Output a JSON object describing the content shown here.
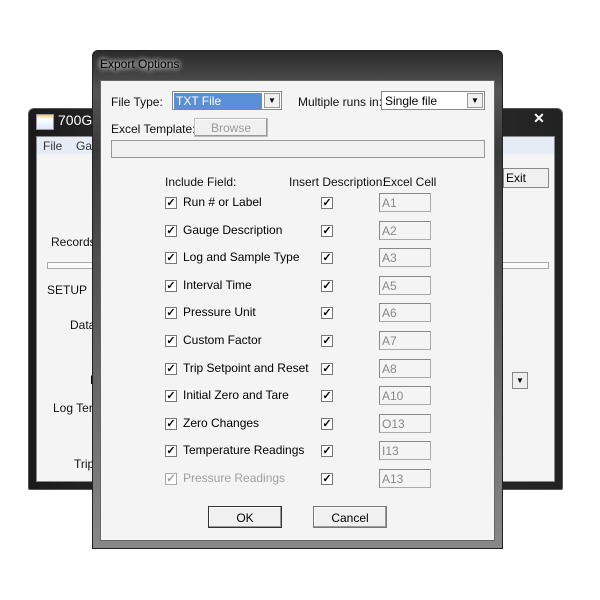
{
  "background_window": {
    "title": "700G",
    "close_icon": "close-icon",
    "menu": [
      "File",
      "Gau"
    ],
    "left_labels": [
      "Records",
      "SETUP",
      "Data",
      "L",
      "Log Tem",
      "Trip"
    ],
    "exit_label": "Exit"
  },
  "dialog": {
    "title": "Export Options",
    "file_type_label": "File Type:",
    "file_type_value": "TXT File",
    "multiple_runs_label": "Multiple runs in:",
    "multiple_runs_value": "Single file",
    "excel_template_label": "Excel Template:",
    "browse_label": "Browse",
    "template_path": "",
    "headers": {
      "include": "Include Field:",
      "insert": "Insert Description:",
      "cell": "Excel Cell"
    },
    "fields": [
      {
        "label": "Run # or Label",
        "include": true,
        "insert": true,
        "cell": "A1",
        "disabled": false
      },
      {
        "label": "Gauge Description",
        "include": true,
        "insert": true,
        "cell": "A2",
        "disabled": false
      },
      {
        "label": "Log and Sample Type",
        "include": true,
        "insert": true,
        "cell": "A3",
        "disabled": false
      },
      {
        "label": "Interval Time",
        "include": true,
        "insert": true,
        "cell": "A5",
        "disabled": false
      },
      {
        "label": "Pressure Unit",
        "include": true,
        "insert": true,
        "cell": "A6",
        "disabled": false
      },
      {
        "label": "Custom Factor",
        "include": true,
        "insert": true,
        "cell": "A7",
        "disabled": false
      },
      {
        "label": "Trip Setpoint and Reset",
        "include": true,
        "insert": true,
        "cell": "A8",
        "disabled": false
      },
      {
        "label": "Initial Zero and Tare",
        "include": true,
        "insert": true,
        "cell": "A10",
        "disabled": false
      },
      {
        "label": "Zero Changes",
        "include": true,
        "insert": true,
        "cell": "O13",
        "disabled": false
      },
      {
        "label": "Temperature Readings",
        "include": true,
        "insert": true,
        "cell": "I13",
        "disabled": false
      },
      {
        "label": "Pressure Readings",
        "include": true,
        "insert": true,
        "cell": "A13",
        "disabled": true
      }
    ],
    "ok_label": "OK",
    "cancel_label": "Cancel"
  }
}
